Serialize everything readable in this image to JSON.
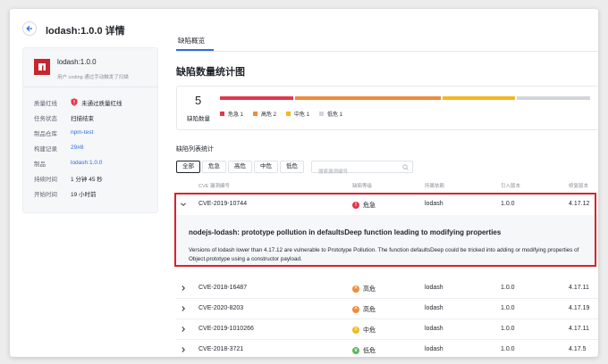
{
  "header": {
    "title": "lodash:1.0.0 详情"
  },
  "sidebar": {
    "package_name": "lodash:1.0.0",
    "package_desc": "用户 coding 通过手动触发了扫描",
    "meta": [
      {
        "label": "质量红线",
        "value": "未通过质量红线"
      },
      {
        "label": "任务状态",
        "value": "扫描结束"
      },
      {
        "label": "制品仓库",
        "value": "npm-test"
      },
      {
        "label": "构建记录",
        "value": "29#8"
      },
      {
        "label": "制品",
        "value": "lodash:1.0.0"
      },
      {
        "label": "持续时间",
        "value": "1 分钟 45 秒"
      },
      {
        "label": "开始时间",
        "value": "19 小时前"
      }
    ]
  },
  "tabs": [
    {
      "label": "缺陷概览",
      "active": true
    }
  ],
  "stats": {
    "title": "缺陷数量统计图",
    "total": "5",
    "total_label": "缺陷数量",
    "segments": [
      {
        "label": "危急 1",
        "count": 1,
        "color": "#e5364d"
      },
      {
        "label": "高危 2",
        "count": 2,
        "color": "#ef8b3a"
      },
      {
        "label": "中危 1",
        "count": 1,
        "color": "#f2b81f"
      },
      {
        "label": "低危 1",
        "count": 1,
        "color": "#d2d6dc"
      }
    ]
  },
  "list": {
    "title": "缺陷列表统计",
    "filters": [
      "全部",
      "危急",
      "高危",
      "中危",
      "低危"
    ],
    "active_filter": "全部",
    "search_placeholder": "搜索漏洞编号",
    "columns": [
      "CVE 漏洞编号",
      "缺陷等级",
      "所属依赖",
      "引入版本",
      "修复版本"
    ],
    "rows": [
      {
        "cve": "CVE-2019-10744",
        "level": "危急",
        "level_color": "#e5364d",
        "level_glyph": "!",
        "dep": "lodash",
        "intro": "1.0.0",
        "fix": "4.17.12",
        "expanded": true
      },
      {
        "cve": "CVE-2018-16487",
        "level": "高危",
        "level_color": "#ef8b3a",
        "level_glyph": "^",
        "dep": "lodash",
        "intro": "1.0.0",
        "fix": "4.17.11"
      },
      {
        "cve": "CVE-2020-8203",
        "level": "高危",
        "level_color": "#ef8b3a",
        "level_glyph": "^",
        "dep": "lodash",
        "intro": "1.0.0",
        "fix": "4.17.19"
      },
      {
        "cve": "CVE-2019-1010266",
        "level": "中危",
        "level_color": "#f2b81f",
        "level_glyph": "=",
        "dep": "lodash",
        "intro": "1.0.0",
        "fix": "4.17.11"
      },
      {
        "cve": "CVE-2018-3721",
        "level": "低危",
        "level_color": "#5cb85c",
        "level_glyph": "v",
        "dep": "lodash",
        "intro": "1.0.0",
        "fix": "4.17.5"
      }
    ],
    "detail": {
      "title": "nodejs-lodash: prototype pollution in defaultsDeep function leading to modifying properties",
      "text": "Versions of lodash lower than 4.17.12 are vulnerable to Prototype Pollution. The function defaultsDeep could be tricked into adding or modifying properties of Object.prototype using a constructor payload."
    }
  },
  "icons": {
    "back": "arrow-left-icon",
    "logo": "npm-logo-icon",
    "quality": "shield-alert-icon",
    "search": "search-icon",
    "expand": "chevron-down-icon",
    "collapse": "chevron-right-icon"
  }
}
